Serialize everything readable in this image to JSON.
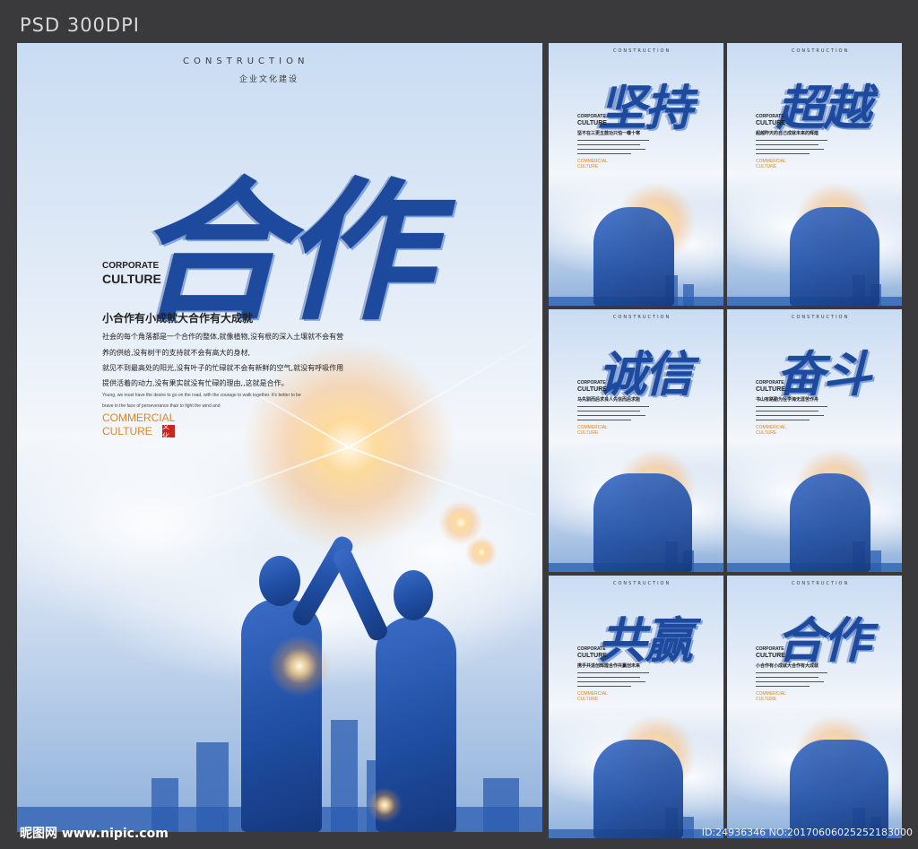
{
  "header": {
    "label": "PSD  300DPI"
  },
  "main_poster": {
    "construction": "CONSTRUCTION",
    "subtitle": "企业文化建设",
    "title": "合作",
    "corporate": "CORPORATE",
    "culture": "CULTURE",
    "slogan": "小合作有小成就大合作有大成就",
    "paragraph": [
      "社会的每个角落都是一个合作的整体,就像植物,没有根的深入土壤就不会有营",
      "养的供给,没有树干的支持就不会有高大的身材,",
      "就见不到最高处的阳光,没有叶子的忙碌就不会有新鲜的空气,就没有呼吸作用",
      "提供活着的动力,没有果实就没有忙碌的理由,,这就是合作。"
    ],
    "english": [
      "Young, we must have the desire to go on the road, with the courage to walk together. It's better to be",
      "brave in the face of perseverance than to fight the wind and"
    ],
    "commercial": "COMMERCIAL",
    "culture2": "CULTURE",
    "seal": "文化"
  },
  "small_posters": [
    {
      "construction": "CONSTRUCTION",
      "title": "坚持",
      "corporate": "CORPORATE",
      "culture": "CULTURE",
      "line": "坚不在三更五鼓功只怕一曝十寒",
      "commercial": "COMMERCIAL",
      "culture2": "CULTURE"
    },
    {
      "construction": "CONSTRUCTION",
      "title": "超越",
      "corporate": "CORPORATE",
      "culture": "CULTURE",
      "line": "超越昨天的自己成就未来的辉煌",
      "commercial": "COMMERCIAL",
      "culture2": "CULTURE"
    },
    {
      "construction": "CONSTRUCTION",
      "title": "诚信",
      "corporate": "CORPORATE",
      "culture": "CULTURE",
      "line": "马先驯而后求良人先信而后求能",
      "commercial": "COMMERCIAL",
      "culture2": "CULTURE"
    },
    {
      "construction": "CONSTRUCTION",
      "title": "奋斗",
      "corporate": "CORPORATE",
      "culture": "CULTURE",
      "line": "书山有路勤为径学海无涯苦作舟",
      "commercial": "COMMERCIAL",
      "culture2": "CULTURE"
    },
    {
      "construction": "CONSTRUCTION",
      "title": "共赢",
      "corporate": "CORPORATE",
      "culture": "CULTURE",
      "line": "携手共进创辉煌合作共赢创未来",
      "commercial": "COMMERCIAL",
      "culture2": "CULTURE"
    },
    {
      "construction": "CONSTRUCTION",
      "title": "合作",
      "corporate": "CORPORATE",
      "culture": "CULTURE",
      "line": "小合作有小成就大合作有大成就",
      "commercial": "COMMERCIAL",
      "culture2": "CULTURE"
    }
  ],
  "footer": {
    "site": "昵图网 www.nipic.com",
    "id": "ID:24936346 NO:20170606025252183000"
  },
  "colors": {
    "accent": "#1d4a9c",
    "orange": "#e0861e",
    "seal": "#c8261e",
    "frame": "#3a3a3c"
  }
}
